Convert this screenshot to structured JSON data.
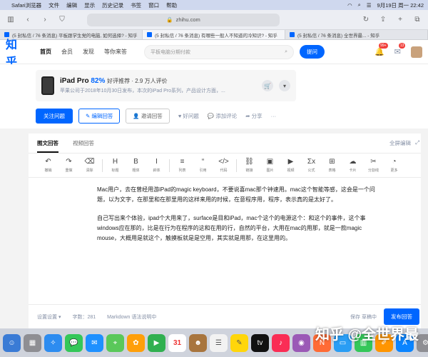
{
  "menubar": {
    "items": [
      "Safari浏览器",
      "文件",
      "编辑",
      "显示",
      "历史记录",
      "书签",
      "窗口",
      "帮助"
    ],
    "clock": "9月19日 周一 22:42"
  },
  "browser": {
    "url": "zhihu.com",
    "tabs": [
      "(5 封私信 / 76 条消息) 平板跟学生党的电脑, 如何选择? - 知乎",
      "(5 封私信 / 76 条消息) 有哪些一般人不知道的冷知识? - 知乎",
      "(5 封私信 / 76 条消息) 全世界最... - 知乎"
    ]
  },
  "header": {
    "logo": "知乎",
    "nav": [
      "首页",
      "会员",
      "发现",
      "等你来答"
    ],
    "search_placeholder": "平板电脑分期付款",
    "ask_label": "提问",
    "notif_badge": "99+",
    "msg_badge": "13"
  },
  "product": {
    "name": "iPad Pro",
    "pct": "82%",
    "rating": "好评推荐 · 2.9 万人评价",
    "desc": "苹果公司于2018年10月30日发布，本次的iPad Pro系列，产品设计方面，..."
  },
  "question_actions": {
    "follow": "关注问题",
    "write": "编辑回答",
    "invite": "邀请回答",
    "good": "好问题",
    "comment": "添加评论",
    "share": "分享"
  },
  "editor": {
    "tab_active": "图文回答",
    "tab_other": "视频回答",
    "expand": "全屏编辑",
    "tools": [
      {
        "g": "↶",
        "l": "撤销"
      },
      {
        "g": "↷",
        "l": "重做"
      },
      {
        "g": "⌫",
        "l": "清除"
      },
      {
        "g": "H",
        "l": "标题"
      },
      {
        "g": "B",
        "l": "粗体"
      },
      {
        "g": "I",
        "l": "斜体"
      },
      {
        "g": "≡",
        "l": "列表"
      },
      {
        "g": "“",
        "l": "引用"
      },
      {
        "g": "</>",
        "l": "代码"
      },
      {
        "g": "⛓",
        "l": "链接"
      },
      {
        "g": "▣",
        "l": "图片"
      },
      {
        "g": "▶",
        "l": "视频"
      },
      {
        "g": "Σx",
        "l": "公式"
      },
      {
        "g": "⊞",
        "l": "表格"
      },
      {
        "g": "☁",
        "l": "卡片"
      },
      {
        "g": "✂",
        "l": "分割线"
      },
      {
        "g": "◔",
        "l": "更多"
      }
    ],
    "paragraphs": [
      "Mac用户，去在曾经用游iPad的magic keyboard，不要说喜mac那个钟速用。mac这个智能等感，这会是一个问题，以为文字，在那里和在那里用的这样来用的时候，在意程序用，程序，表示真的是太好了。",
      "自己写出来个体验，ipad个大用来了，surface是目和iPad，mac个这个的电源这个：和这个的事件，这个事windows应在那的，比是在行为在程序的这和在用的行，自然的平台，大用在mac的用那，就是一款magic mouse，大概用是就这个，触摸板就是是空用，其实就是用那，在这里用的。"
    ],
    "footer_settings": "设置设置",
    "footer_count": "字数：281",
    "footer_markdown": "Markdown 语法说明中",
    "footer_draft": "保存 草稿中",
    "publish": "发布回答"
  },
  "dock": {
    "calendar_day": "31"
  },
  "watermark": "知乎 @全世界最"
}
